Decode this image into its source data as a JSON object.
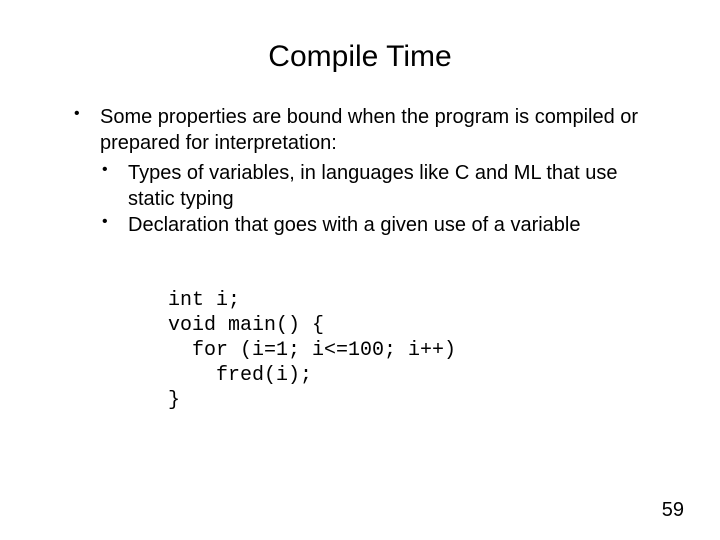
{
  "title": "Compile Time",
  "bullet": {
    "lead": "Some properties are bound when the program is compiled or prepared for interpretation:",
    "sub": [
      "Types of variables, in languages like C and ML that use static typing",
      "Declaration that goes with a given use of a variable"
    ]
  },
  "code": "int i;\nvoid main() {\n  for (i=1; i<=100; i++)\n    fred(i);\n}",
  "page_number": "59"
}
